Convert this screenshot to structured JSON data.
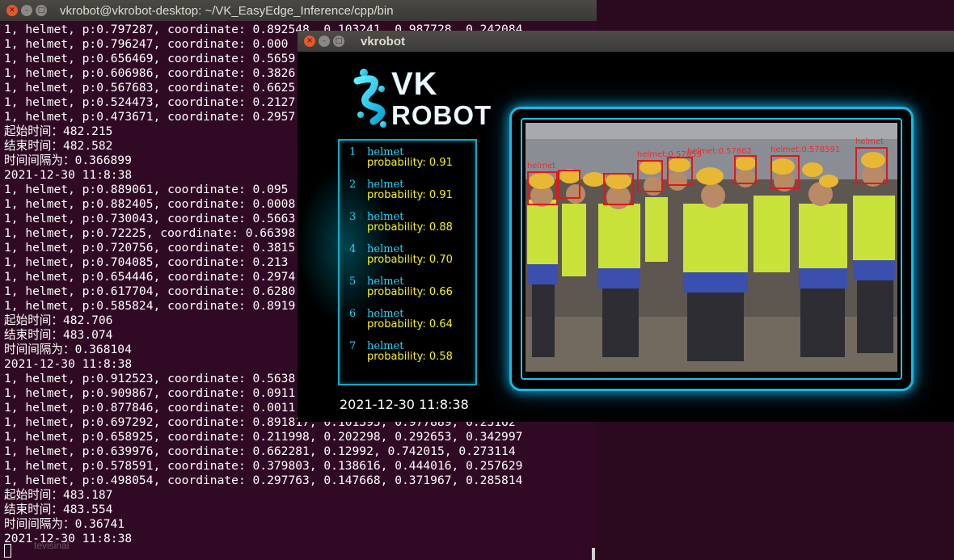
{
  "terminal": {
    "title": "vkrobot@vkrobot-desktop: ~/VK_EasyEdge_Inference/cpp/bin",
    "lines": [
      "1, helmet, p:0.797287, coordinate: 0.892548, 0.103241, 0.987728, 0.242084",
      "1, helmet, p:0.796247, coordinate: 0.000",
      "1, helmet, p:0.656469, coordinate: 0.5659",
      "1, helmet, p:0.606986, coordinate: 0.3826",
      "1, helmet, p:0.567683, coordinate: 0.6625",
      "1, helmet, p:0.524473, coordinate: 0.2127",
      "1, helmet, p:0.473671, coordinate: 0.2957",
      "起始时间：482.215",
      "结束时间：482.582",
      "时间间隔为：0.366899",
      "2021-12-30 11:8:38",
      "1, helmet, p:0.889061, coordinate: 0.095",
      "1, helmet, p:0.882405, coordinate: 0.0008",
      "1, helmet, p:0.730043, coordinate: 0.5663",
      "1, helmet, p:0.72225, coordinate: 0.66398",
      "1, helmet, p:0.720756, coordinate: 0.3815",
      "1, helmet, p:0.704085, coordinate: 0.213",
      "1, helmet, p:0.654446, coordinate: 0.2974",
      "1, helmet, p:0.617704, coordinate: 0.6280",
      "1, helmet, p:0.585824, coordinate: 0.8919",
      "起始时间：482.706",
      "结束时间：483.074",
      "时间间隔为：0.368104",
      "2021-12-30 11:8:38",
      "1, helmet, p:0.912523, coordinate: 0.5638",
      "1, helmet, p:0.909867, coordinate: 0.0911",
      "1, helmet, p:0.877846, coordinate: 0.0011",
      "1, helmet, p:0.697292, coordinate: 0.891817, 0.101395, 0.977889, 0.23162",
      "1, helmet, p:0.658925, coordinate: 0.211998, 0.202298, 0.292653, 0.342997",
      "1, helmet, p:0.639976, coordinate: 0.662281, 0.12992, 0.742015, 0.273114",
      "1, helmet, p:0.578591, coordinate: 0.379803, 0.138616, 0.444016, 0.257629",
      "1, helmet, p:0.498054, coordinate: 0.297763, 0.147668, 0.371967, 0.285814",
      "起始时间：483.187",
      "结束时间：483.554",
      "时间间隔为：0.36741",
      "2021-12-30 11:8:38"
    ],
    "ghost_text": "tevisinal"
  },
  "vk_window": {
    "title": "vkrobot",
    "logo_line1": "VK",
    "logo_line2": "ROBOT",
    "detections": [
      {
        "num": "1",
        "label": "helmet",
        "prob": "probability: 0.91"
      },
      {
        "num": "2",
        "label": "helmet",
        "prob": "probability: 0.91"
      },
      {
        "num": "3",
        "label": "helmet",
        "prob": "probability: 0.88"
      },
      {
        "num": "4",
        "label": "helmet",
        "prob": "probability: 0.70"
      },
      {
        "num": "5",
        "label": "helmet",
        "prob": "probability: 0.66"
      },
      {
        "num": "6",
        "label": "helmet",
        "prob": "probability: 0.64"
      },
      {
        "num": "7",
        "label": "helmet",
        "prob": "probability: 0.58"
      }
    ],
    "timestamp": "2021-12-30  11:8:38",
    "box_labels": [
      "helmet",
      "helmet:0.57859",
      "helmet:0.57862",
      "helmet:0.578591",
      "helmet"
    ],
    "colors": {
      "accent": "#1ab8e0",
      "label": "#22d6ff",
      "probability": "#f7f21c",
      "box": "#e01818",
      "terminal_bg": "#300a24"
    }
  }
}
